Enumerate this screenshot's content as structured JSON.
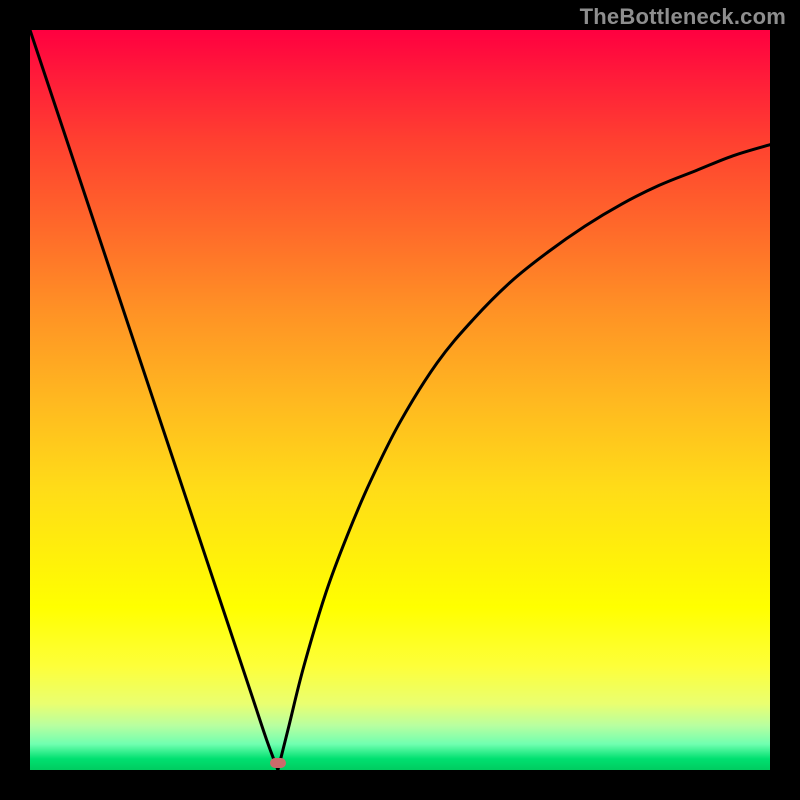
{
  "watermark": "TheBottleneck.com",
  "colors": {
    "background": "#000000",
    "curve_stroke": "#000000",
    "marker_fill": "#cc6b6b",
    "gradient_top": "#ff0040",
    "gradient_bottom": "#00cc60"
  },
  "chart_data": {
    "type": "line",
    "title": "",
    "xlabel": "",
    "ylabel": "",
    "xlim": [
      0,
      100
    ],
    "ylim": [
      0,
      100
    ],
    "grid": false,
    "series": [
      {
        "name": "left-branch",
        "x": [
          0,
          3,
          6,
          9,
          12,
          15,
          18,
          21,
          24,
          27,
          30,
          32,
          33.5
        ],
        "values": [
          100,
          91,
          82,
          73,
          64,
          55,
          46,
          37,
          28,
          19,
          10,
          4,
          0
        ]
      },
      {
        "name": "right-branch",
        "x": [
          33.5,
          35,
          37,
          40,
          43,
          46,
          50,
          55,
          60,
          65,
          70,
          75,
          80,
          85,
          90,
          95,
          100
        ],
        "values": [
          0,
          6,
          14,
          24,
          32,
          39,
          47,
          55,
          61,
          66,
          70,
          73.5,
          76.5,
          79,
          81,
          83,
          84.5
        ]
      }
    ],
    "marker": {
      "x": 33.5,
      "y": 1.0
    },
    "notes": "Values are estimated from pixel positions; x is horizontal fraction of plot area (0=left, 100=right), y is vertical fraction (0=bottom, 100=top)."
  }
}
